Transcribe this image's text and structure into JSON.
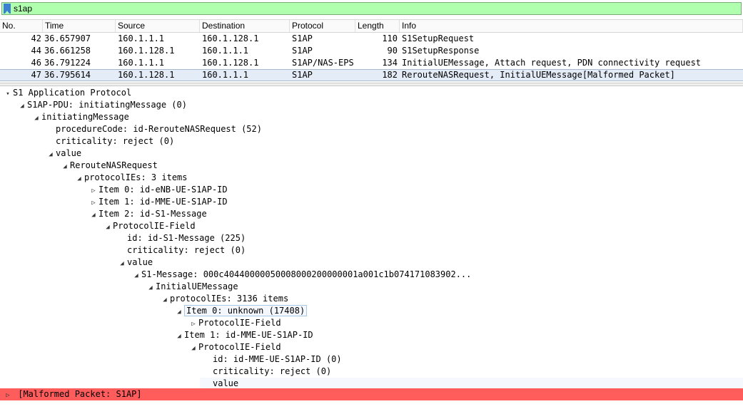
{
  "filter": {
    "value": "s1ap"
  },
  "packet_list": {
    "columns": [
      "No.",
      "Time",
      "Source",
      "Destination",
      "Protocol",
      "Length",
      "Info"
    ],
    "rows": [
      {
        "no": "42",
        "time": "36.657907",
        "src": "160.1.1.1",
        "dst": "160.1.128.1",
        "proto": "S1AP",
        "len": "110",
        "info": "S1SetupRequest"
      },
      {
        "no": "44",
        "time": "36.661258",
        "src": "160.1.128.1",
        "dst": "160.1.1.1",
        "proto": "S1AP",
        "len": "90",
        "info": "S1SetupResponse"
      },
      {
        "no": "46",
        "time": "36.791224",
        "src": "160.1.1.1",
        "dst": "160.1.128.1",
        "proto": "S1AP/NAS-EPS",
        "len": "134",
        "info": "InitialUEMessage, Attach request, PDN connectivity request"
      },
      {
        "no": "47",
        "time": "36.795614",
        "src": "160.1.128.1",
        "dst": "160.1.1.1",
        "proto": "S1AP",
        "len": "182",
        "info": "RerouteNASRequest, InitialUEMessage[Malformed Packet]"
      }
    ]
  },
  "tree": [
    {
      "text": "S1 Application Protocol",
      "indent": 0,
      "tog": "▾"
    },
    {
      "text": "S1AP-PDU: initiatingMessage (0)",
      "indent": 1,
      "tog": "◢"
    },
    {
      "text": "initiatingMessage",
      "indent": 2,
      "tog": "◢"
    },
    {
      "text": "procedureCode: id-RerouteNASRequest (52)",
      "indent": 3,
      "tog": ""
    },
    {
      "text": "criticality: reject (0)",
      "indent": 3,
      "tog": ""
    },
    {
      "text": "value",
      "indent": 3,
      "tog": "◢"
    },
    {
      "text": "RerouteNASRequest",
      "indent": 4,
      "tog": "◢"
    },
    {
      "text": "protocolIEs: 3 items",
      "indent": 5,
      "tog": "◢"
    },
    {
      "text": "Item 0: id-eNB-UE-S1AP-ID",
      "indent": 6,
      "tog": "▷"
    },
    {
      "text": "Item 1: id-MME-UE-S1AP-ID",
      "indent": 6,
      "tog": "▷"
    },
    {
      "text": "Item 2: id-S1-Message",
      "indent": 6,
      "tog": "◢"
    },
    {
      "text": "ProtocolIE-Field",
      "indent": 7,
      "tog": "◢"
    },
    {
      "text": "id: id-S1-Message (225)",
      "indent": 8,
      "tog": ""
    },
    {
      "text": "criticality: reject (0)",
      "indent": 8,
      "tog": ""
    },
    {
      "text": "value",
      "indent": 8,
      "tog": "◢"
    },
    {
      "text": "S1-Message: 000c40440000050008000200000001a001c1b074171083902...",
      "indent": 9,
      "tog": "◢"
    },
    {
      "text": "InitialUEMessage",
      "indent": 10,
      "tog": "◢"
    },
    {
      "text": "protocolIEs: 3136 items",
      "indent": 11,
      "tog": "◢"
    },
    {
      "text": "Item 0: unknown (17408)",
      "indent": 12,
      "tog": "◢",
      "hl": true
    },
    {
      "text": "ProtocolIE-Field",
      "indent": 13,
      "tog": "▷"
    },
    {
      "text": "Item 1: id-MME-UE-S1AP-ID",
      "indent": 12,
      "tog": "◢"
    },
    {
      "text": "ProtocolIE-Field",
      "indent": 13,
      "tog": "◢"
    },
    {
      "text": "id: id-MME-UE-S1AP-ID (0)",
      "indent": 14,
      "tog": ""
    },
    {
      "text": "criticality: reject (0)",
      "indent": 14,
      "tog": ""
    },
    {
      "text": "value",
      "indent": 14,
      "tog": "",
      "boxed": true
    }
  ],
  "error_row": {
    "text": "[Malformed Packet: S1AP]",
    "tog": "▷"
  },
  "colors": {
    "filter_bg": "#afffaf",
    "error_bg": "#ff5c5c",
    "selected_row": "#e4ecf7"
  }
}
